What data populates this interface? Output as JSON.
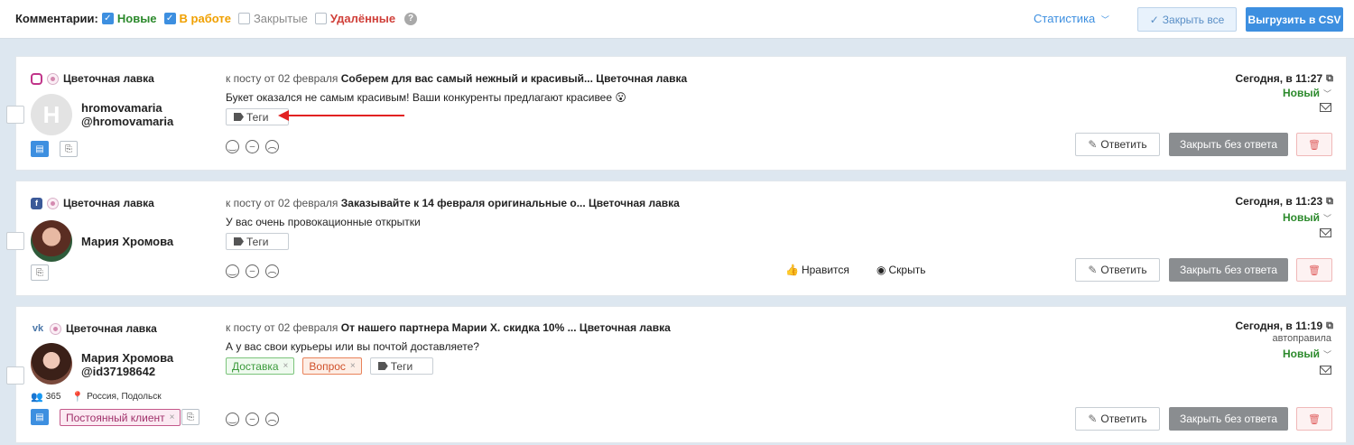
{
  "filters": {
    "label": "Комментарии:",
    "items": [
      {
        "label": "Новые",
        "checked": true
      },
      {
        "label": "В работе",
        "checked": true
      },
      {
        "label": "Закрытые",
        "checked": false
      },
      {
        "label": "Удалённые",
        "checked": false
      }
    ],
    "help": "?"
  },
  "header": {
    "stats": "Статистика",
    "close_all": "Закрыть все",
    "export_csv": "Выгрузить в CSV"
  },
  "colors": {
    "accent": "#3d8fe0",
    "new_status": "#2c8a2c",
    "in_work": "#f0a000",
    "deleted": "#d0403a"
  },
  "common": {
    "post_prefix": "к посту от 02 февраля",
    "tags_button": "Теги",
    "reply": "Ответить",
    "close_no_reply": "Закрыть без ответа",
    "status": "Новый",
    "like": "Нравится",
    "hide": "Скрыть"
  },
  "comments": [
    {
      "network": "instagram-icon",
      "source": "Цветочная лавка",
      "avatar_letter": "H",
      "user_name": "hromovamaria",
      "user_handle": "@hromovamaria",
      "post_title": "Соберем для вас самый нежный и красивый... Цветочная лавка",
      "message": "Букет оказался не самым красивым! Ваши конкуренты предлагают красивее 😮",
      "date": "Сегодня, в 11:27"
    },
    {
      "network": "facebook-icon",
      "source": "Цветочная лавка",
      "user_name": "Мария Хромова",
      "post_title": "Заказывайте к 14 февраля оригинальные о... Цветочная лавка",
      "message": "У вас очень провокационные открытки",
      "date": "Сегодня, в 11:23"
    },
    {
      "network": "vk-icon",
      "source": "Цветочная лавка",
      "user_name": "Мария Хромова",
      "user_handle": "@id37198642",
      "friends": "365",
      "location": "Россия, Подольск",
      "client_tag": "Постоянный клиент",
      "post_title": "От нашего партнера Марии Х. скидка 10% ... Цветочная лавка",
      "message": "А у вас свои курьеры или вы почтой доставляете?",
      "tags": [
        "Доставка",
        "Вопрос"
      ],
      "date": "Сегодня, в 11:19",
      "autorule": "автоправила"
    }
  ]
}
